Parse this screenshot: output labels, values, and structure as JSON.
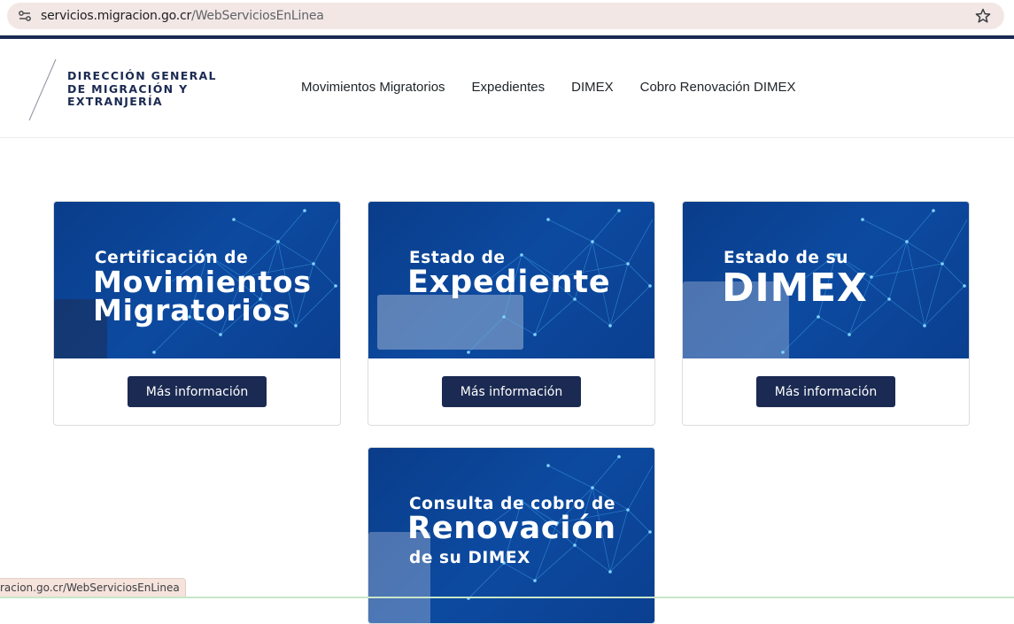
{
  "browser": {
    "url_host": "servicios.migracion.go.cr",
    "url_path": "/WebServiciosEnLinea",
    "status_url": "racion.go.cr/WebServiciosEnLinea"
  },
  "header": {
    "logo_lines": [
      "DIRECCIÓN GENERAL",
      "DE MIGRACIÓN Y",
      "EXTRANJERÍA"
    ],
    "nav": [
      "Movimientos Migratorios",
      "Expedientes",
      "DIMEX",
      "Cobro Renovación DIMEX"
    ]
  },
  "cards": [
    {
      "small": "Certificación de",
      "big1": "Movimientos",
      "big2": "Migratorios",
      "button": "Más información"
    },
    {
      "small": "Estado de",
      "big1": "Expediente",
      "button": "Más información"
    },
    {
      "small": "Estado de su",
      "big1": "DIMEX",
      "button": "Más información"
    },
    {
      "small": "Consulta de cobro de",
      "big1": "Renovación",
      "small2": "de su DIMEX"
    }
  ],
  "colors": {
    "navy": "#1b2a52",
    "card_blue": "#0c4aa0",
    "network": "#4fb8ff"
  }
}
